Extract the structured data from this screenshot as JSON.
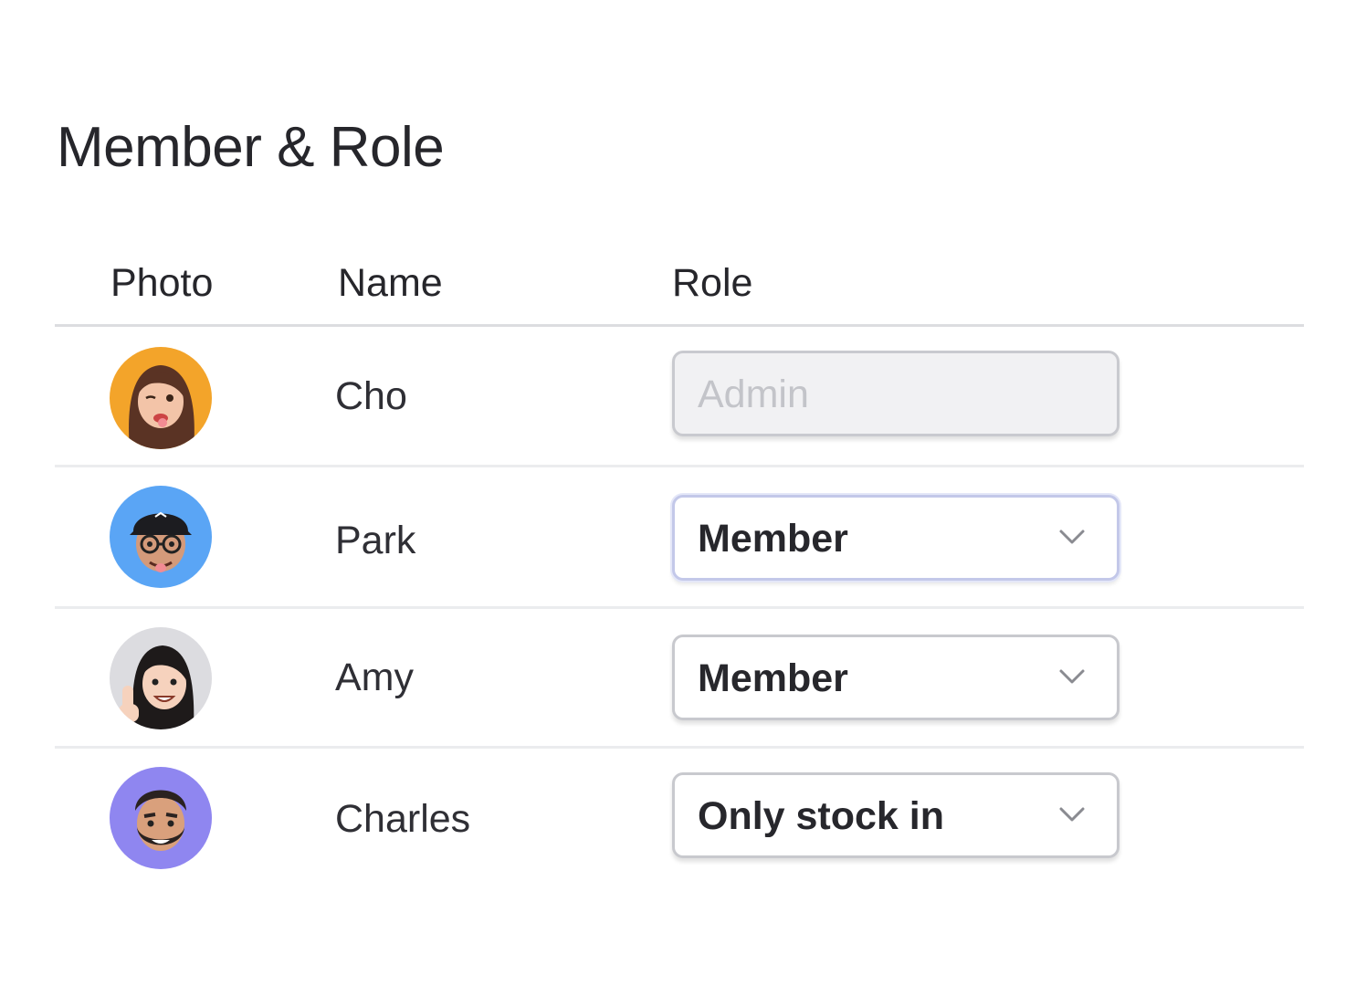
{
  "page": {
    "title": "Member & Role"
  },
  "table": {
    "columns": {
      "photo": "Photo",
      "name": "Name",
      "role": "Role"
    },
    "rows": [
      {
        "name": "Cho",
        "role": "Admin",
        "role_editable": false,
        "avatar_bg": "#f3a42a"
      },
      {
        "name": "Park",
        "role": "Member",
        "role_editable": true,
        "focused": true,
        "avatar_bg": "#5aa5f5"
      },
      {
        "name": "Amy",
        "role": "Member",
        "role_editable": true,
        "avatar_bg": "#dcdce0"
      },
      {
        "name": "Charles",
        "role": "Only stock in",
        "role_editable": true,
        "avatar_bg": "#8f86f0"
      }
    ]
  },
  "icons": {
    "dropdown": "chevron-down-icon"
  },
  "colors": {
    "text": "#26262b",
    "divider": "#dcdde0",
    "select_border": "#c8c9ce",
    "select_focus_border": "#c3c8e9",
    "disabled_bg": "#f1f1f3",
    "disabled_text": "#c3c4c9"
  }
}
